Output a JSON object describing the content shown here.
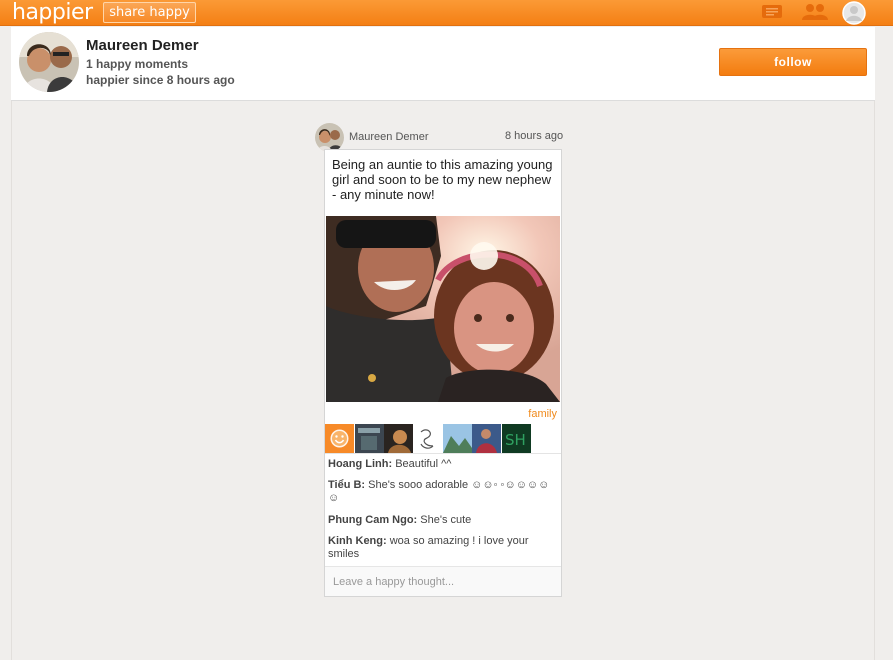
{
  "topbar": {
    "logo": "happier",
    "share_label": "share happy",
    "accent": "#f7861f"
  },
  "profile": {
    "name": "Maureen Demer",
    "moments": "1 happy moments",
    "since": "happier since 8 hours ago",
    "follow_label": "follow"
  },
  "post": {
    "author": "Maureen Demer",
    "time": "8 hours ago",
    "text": "Being an auntie to this amazing young girl and soon to be to my new nephew - any minute now!",
    "tag": "family",
    "comments": [
      {
        "author": "Hoang Linh:",
        "text": " Beautiful ^^"
      },
      {
        "author": "Tiểu B:",
        "text": " She's sooo adorable ☺☺◦ ◦☺☺☺☺☺"
      },
      {
        "author": "Phung Cam Ngo:",
        "text": " She's cute"
      },
      {
        "author": "Kinh Keng:",
        "text": " woa so amazing ! i love your smiles"
      }
    ],
    "comment_placeholder": "Leave a happy thought..."
  }
}
